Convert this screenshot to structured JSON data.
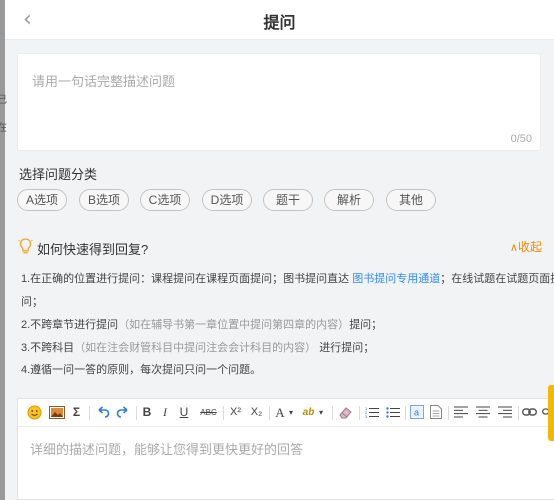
{
  "header": {
    "title": "提问",
    "back_icon": "chevron-left-icon"
  },
  "question": {
    "placeholder": "请用一句话完整描述问题",
    "counter": "0/50"
  },
  "category": {
    "title": "选择问题分类",
    "options": [
      "A选项",
      "B选项",
      "C选项",
      "D选项",
      "题干",
      "解析",
      "其他"
    ]
  },
  "tips": {
    "title": "如何快速得到回复?",
    "collapse_label": "收起",
    "items": [
      {
        "a": "1.在正确的位置进行提问：课程提问在课程页面提问；图书提问直达",
        "link": "图书提问专用通道",
        "b": "；在线试题在试题页面提"
      },
      {
        "a": "问；"
      },
      {
        "a": "2.不跨章节进行提问",
        "gray": "（如在辅导书第一章位置中提问第四章的内容）",
        "b": "提问；"
      },
      {
        "a": "3.不跨科目",
        "gray": "（如在注会财管科目中提问注会会计科目的内容）",
        "b": "进行提问；"
      },
      {
        "a": "4.遵循一问一答的原则，每次提问只问一个问题。"
      }
    ]
  },
  "editor": {
    "placeholder": "详细的描述问题，能够让您得到更快更好的回答",
    "toolbar": {
      "sigma": "Σ",
      "bold": "B",
      "italic": "I",
      "underline": "U",
      "strike": "ABC",
      "sup": "X²",
      "sub": "X₂",
      "font_color": "A",
      "highlight": "ab"
    }
  },
  "colors": {
    "accent": "#2f8cff",
    "orange": "#f08a00",
    "tab": "#f5b800"
  }
}
